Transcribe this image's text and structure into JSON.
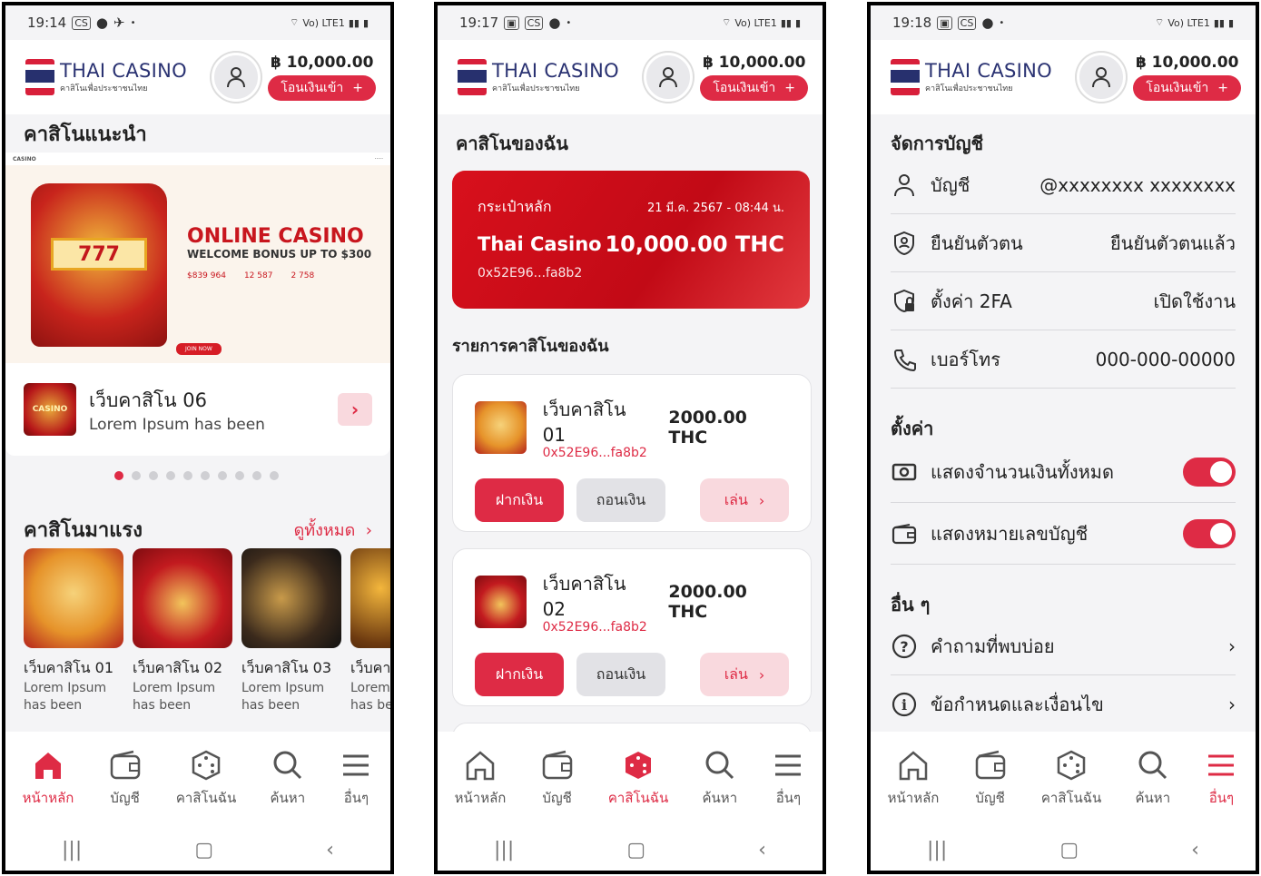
{
  "status": {
    "p1_time": "19:14",
    "p2_time": "19:17",
    "p3_time": "19:18",
    "network": "Vo) LTE1"
  },
  "header": {
    "brand": "THAI CASINO",
    "tagline": "คาสิโนเพื่อประชาชนไทย",
    "balance": "฿ 10,000.00",
    "deposit_label": "โอนเงินเข้า"
  },
  "nav": {
    "home": "หน้าหลัก",
    "account": "บัญชี",
    "mycasino": "คาสิโนฉัน",
    "search": "ค้นหา",
    "more": "อื่นๆ"
  },
  "home": {
    "recommended_title": "คาสิโนแนะนำ",
    "banner": {
      "top_logo": "CASINO",
      "headline": "ONLINE CASINO",
      "subline": "WELCOME BONUS UP TO $300",
      "stat1": "$839 964",
      "stat2": "12 587",
      "stat3": "2 758",
      "slot_digits": "777",
      "join": "JOIN NOW"
    },
    "featured": {
      "thumb": "CASINO",
      "title": "เว็บคาสิโน 06",
      "subtitle": "Lorem Ipsum has been"
    },
    "hot_title": "คาสิโนมาแรง",
    "see_all": "ดูทั้งหมด",
    "games": [
      {
        "title": "เว็บคาสิโน 01",
        "desc": "Lorem Ipsum has been"
      },
      {
        "title": "เว็บคาสิโน 02",
        "desc": "Lorem Ipsum has been"
      },
      {
        "title": "เว็บคาสิโน 03",
        "desc": "Lorem Ipsum has been"
      },
      {
        "title": "เว็บคาสิ",
        "desc": "Lorem has be"
      }
    ]
  },
  "mycasino": {
    "title": "คาสิโนของฉัน",
    "wallet": {
      "label": "กระเป๋าหลัก",
      "date": "21 มี.ค. 2567 - 08:44 น.",
      "name": "Thai Casino",
      "amount": "10,000.00 THC",
      "address": "0x52E96...fa8b2"
    },
    "list_title": "รายการคาสิโนของฉัน",
    "deposit": "ฝากเงิน",
    "withdraw": "ถอนเงิน",
    "play": "เล่น",
    "items": [
      {
        "name": "เว็บคาสิโน 01",
        "address": "0x52E96...fa8b2",
        "value": "2000.00 THC"
      },
      {
        "name": "เว็บคาสิโน 02",
        "address": "0x52E96...fa8b2",
        "value": "2000.00 THC"
      }
    ]
  },
  "settings": {
    "manage_title": "จัดการบัญชี",
    "account_label": "บัญชี",
    "account_value": "@xxxxxxxx xxxxxxxx",
    "verify_label": "ยืนยันตัวตน",
    "verify_value": "ยืนยันตัวตนแล้ว",
    "twofa_label": "ตั้งค่า 2FA",
    "twofa_value": "เปิดใช้งาน",
    "phone_label": "เบอร์โทร",
    "phone_value": "000-000-00000",
    "settings_title": "ตั้งค่า",
    "show_balance": "แสดงจำนวนเงินทั้งหมด",
    "show_account_no": "แสดงหมายเลขบัญชี",
    "others_title": "อื่น ๆ",
    "faq": "คำถามที่พบบ่อย",
    "terms": "ข้อกำหนดและเงื่อนไข"
  },
  "colors": {
    "accent": "#de2b45",
    "brand_blue": "#2a3272"
  }
}
